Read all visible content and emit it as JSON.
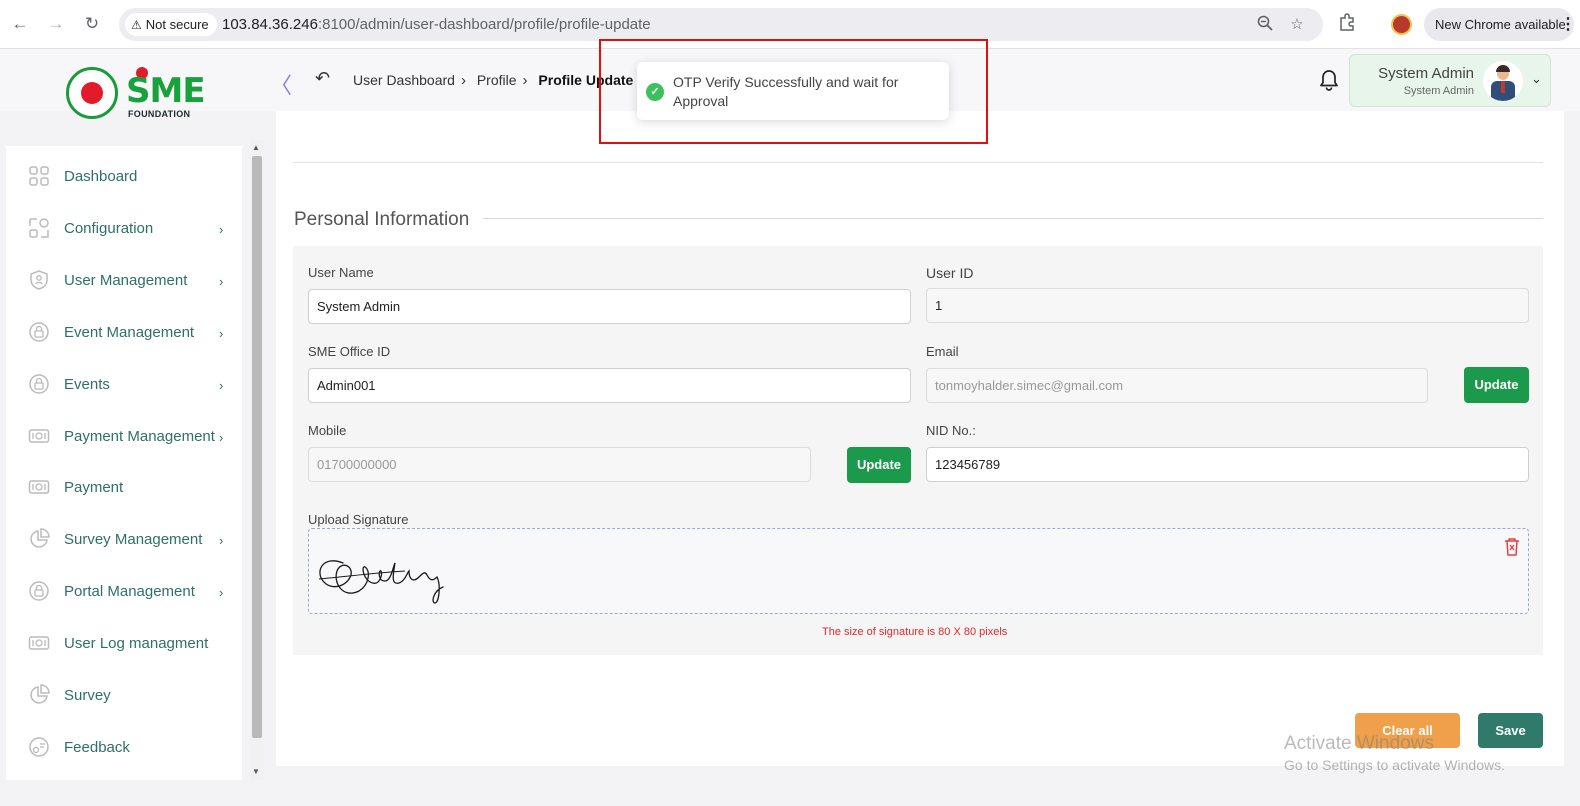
{
  "browser": {
    "security_label": "Not secure",
    "url_host": "103.84.36.246",
    "url_rest": ":8100/admin/user-dashboard/profile/profile-update",
    "new_chrome_label": "New Chrome available"
  },
  "header": {
    "logo_text": "SME",
    "logo_sub": "FOUNDATION",
    "breadcrumb": [
      "User Dashboard",
      "Profile",
      "Profile Update"
    ],
    "user_name": "System Admin",
    "user_role": "System Admin"
  },
  "toast": {
    "message": "OTP Verify Successfully and wait for Approval",
    "color": "#3cc25a"
  },
  "sidebar": {
    "items": [
      {
        "label": "Dashboard",
        "icon": "grid-icon",
        "has_children": false
      },
      {
        "label": "Configuration",
        "icon": "shapes-icon",
        "has_children": true
      },
      {
        "label": "User Management",
        "icon": "shield-user-icon",
        "has_children": true
      },
      {
        "label": "Event Management",
        "icon": "lock-circle-icon",
        "has_children": true
      },
      {
        "label": "Events",
        "icon": "lock-circle-icon",
        "has_children": true
      },
      {
        "label": "Payment Management",
        "icon": "money-icon",
        "has_children": true
      },
      {
        "label": "Payment",
        "icon": "money-icon",
        "has_children": false
      },
      {
        "label": "Survey Management",
        "icon": "pie-chart-icon",
        "has_children": true
      },
      {
        "label": "Portal Management",
        "icon": "lock-circle-icon",
        "has_children": true
      },
      {
        "label": "User Log managment",
        "icon": "money-icon",
        "has_children": false
      },
      {
        "label": "Survey",
        "icon": "pie-chart-icon",
        "has_children": false
      },
      {
        "label": "Feedback",
        "icon": "feedback-icon",
        "has_children": false
      }
    ]
  },
  "form": {
    "section_title": "Personal Information",
    "user_name_label": "User Name",
    "user_name_value": "System Admin",
    "user_id_label": "User ID",
    "user_id_value": "1",
    "office_id_label": "SME Office ID",
    "office_id_value": "Admin001",
    "email_label": "Email",
    "email_value": "tonmoyhalder.simec@gmail.com",
    "mobile_label": "Mobile",
    "mobile_value": "01700000000",
    "nid_label": "NID No.:",
    "nid_value": "123456789",
    "update_label": "Update",
    "signature_label": "Upload Signature",
    "signature_note": "The size of signature is 80 X 80 pixels"
  },
  "actions": {
    "clear_label": "Clear all",
    "save_label": "Save"
  },
  "watermark": {
    "line1": "Activate Windows",
    "line2": "Go to Settings to activate Windows."
  },
  "colors": {
    "brand_green": "#1a9a4a",
    "save_teal": "#2f7a6b",
    "clear_orange": "#f0a04a",
    "sidebar_text": "#2f6f6a",
    "error_red": "#e02b2b"
  }
}
